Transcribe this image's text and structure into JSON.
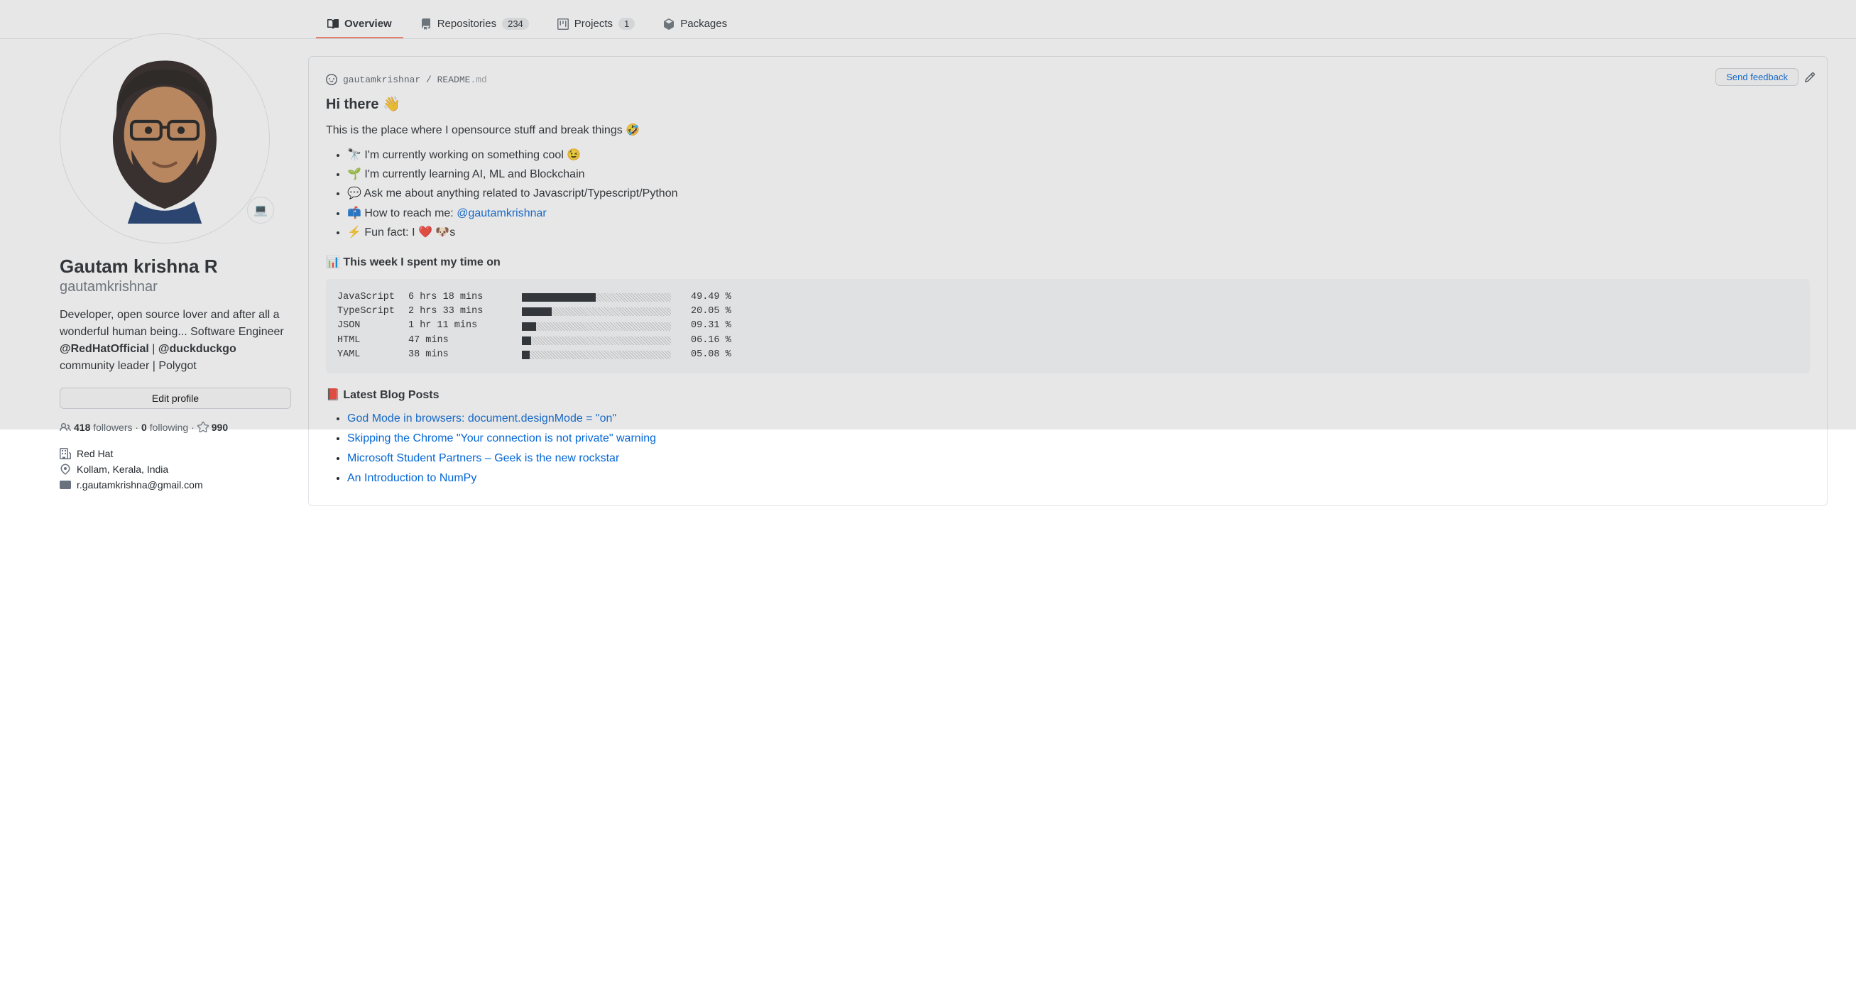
{
  "tabs": {
    "overview": "Overview",
    "repositories": "Repositories",
    "repositories_count": "234",
    "projects": "Projects",
    "projects_count": "1",
    "packages": "Packages"
  },
  "profile": {
    "status_emoji": "💻",
    "fullname": "Gautam krishna R",
    "username": "gautamkrishnar",
    "bio_1": "Developer, open source lover and after all a wonderful human being... Software Engineer ",
    "bio_m1": "@RedHatOfficial",
    "bio_2": " | ",
    "bio_m2": "@duckduckgo",
    "bio_3": " community leader | Polygot",
    "edit_label": "Edit profile",
    "followers_count": "418",
    "followers_label": " followers · ",
    "following_count": "0",
    "following_label": " following · ",
    "stars_count": "990",
    "company": "Red Hat",
    "location": "Kollam, Kerala, India",
    "email": "r.gautamkrishna@gmail.com"
  },
  "readme": {
    "path_user": "gautamkrishnar",
    "path_sep": " / ",
    "path_file": "README",
    "path_ext": ".md",
    "feedback_label": "Send feedback",
    "heading": "Hi there 👋",
    "intro": "This is the place where I opensource stuff and break things 🤣",
    "bullets": {
      "b1": "🔭 I'm currently working on something cool 😉",
      "b2": "🌱 I'm currently learning AI, ML and Blockchain",
      "b3": "💬 Ask me about anything related to Javascript/Typescript/Python",
      "b4_pre": "📫 How to reach me: ",
      "b4_link": "@gautamkrishnar",
      "b5": "⚡ Fun fact: I ❤️ 🐶s"
    },
    "time_heading": "📊 This week I spent my time on",
    "blog_heading": "📕 Latest Blog Posts"
  },
  "chart_data": {
    "type": "bar",
    "rows": [
      {
        "lang": "JavaScript",
        "time": "6 hrs 18 mins",
        "pct": 49.49,
        "pct_label": "49.49 %"
      },
      {
        "lang": "TypeScript",
        "time": "2 hrs 33 mins",
        "pct": 20.05,
        "pct_label": "20.05 %"
      },
      {
        "lang": "JSON",
        "time": "1 hr 11 mins",
        "pct": 9.31,
        "pct_label": "09.31 %"
      },
      {
        "lang": "HTML",
        "time": "47 mins",
        "pct": 6.16,
        "pct_label": "06.16 %"
      },
      {
        "lang": "YAML",
        "time": "38 mins",
        "pct": 5.08,
        "pct_label": "05.08 %"
      }
    ]
  },
  "blog_posts": [
    "God Mode in browsers: document.designMode = \"on\"",
    "Skipping the Chrome \"Your connection is not private\" warning",
    "Microsoft Student Partners – Geek is the new rockstar",
    "An Introduction to NumPy"
  ]
}
